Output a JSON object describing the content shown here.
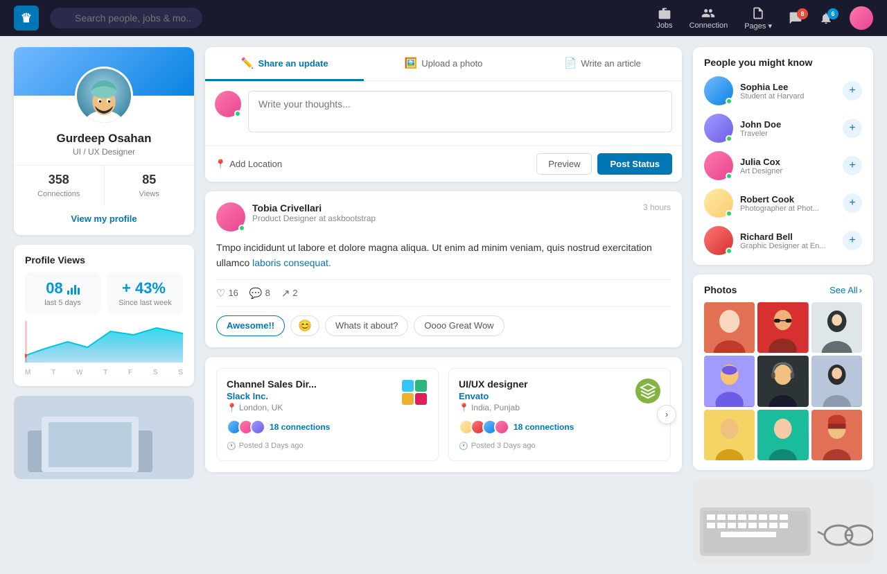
{
  "nav": {
    "logo": "♛",
    "search_placeholder": "Search people, jobs & mo...",
    "jobs_label": "Jobs",
    "connection_label": "Connection",
    "pages_label": "Pages",
    "notification_badge": "8",
    "message_badge": "6"
  },
  "left_panel": {
    "profile": {
      "name": "Gurdeep Osahan",
      "title": "UI / UX Designer",
      "connections_count": "358",
      "connections_label": "Connections",
      "views_count": "85",
      "views_label": "Views",
      "view_profile_link": "View my profile"
    },
    "profile_views": {
      "title": "Profile Views",
      "last5_num": "08",
      "last5_label": "last 5 days",
      "pct_num": "+ 43%",
      "pct_label": "Since last week",
      "chart_days": [
        "M",
        "T",
        "W",
        "T",
        "F",
        "S",
        "S"
      ]
    }
  },
  "composer": {
    "tab_update": "Share an update",
    "tab_photo": "Upload a photo",
    "tab_article": "Write an article",
    "placeholder": "Write your thoughts...",
    "location_btn": "Add Location",
    "preview_btn": "Preview",
    "post_btn": "Post Status"
  },
  "post": {
    "author_name": "Tobia Crivellari",
    "author_role": "Product Designer at askbootstrap",
    "time": "3 hours",
    "body_text": "Tmpo incididunt ut labore et dolore magna aliqua. Ut enim ad minim veniam, quis nostrud exercitation ullamco ",
    "body_link": "laboris consequat.",
    "likes": "16",
    "comments": "8",
    "shares": "2",
    "reaction_awesome": "Awesome!!",
    "reaction_whats": "Whats it about?",
    "reaction_ooo": "Oooo Great Wow"
  },
  "jobs": [
    {
      "title": "Channel Sales Dir...",
      "company": "Slack Inc.",
      "location": "London, UK",
      "connections": "18 connections",
      "posted": "Posted 3 Days ago",
      "logo_type": "slack"
    },
    {
      "title": "UI/UX designer",
      "company": "Envato",
      "location": "India, Punjab",
      "connections": "18 connections",
      "posted": "Posted 3 Days ago",
      "logo_type": "envato"
    }
  ],
  "right_panel": {
    "people_title": "People you might know",
    "people": [
      {
        "name": "Sophia Lee",
        "role": "Student at Harvard",
        "av_class": "av-1"
      },
      {
        "name": "John Doe",
        "role": "Traveler",
        "av_class": "av-2"
      },
      {
        "name": "Julia Cox",
        "role": "Art Designer",
        "av_class": "av-3"
      },
      {
        "name": "Robert Cook",
        "role": "Photographer at Phot...",
        "av_class": "av-4"
      },
      {
        "name": "Richard Bell",
        "role": "Graphic Designer at En...",
        "av_class": "av-5"
      }
    ],
    "photos_title": "Photos",
    "photos_see_all": "See All",
    "photo_classes": [
      "pg1",
      "pg2",
      "pg3",
      "pg4",
      "pg5",
      "pg6",
      "pg7",
      "pg8",
      "pg9"
    ]
  }
}
